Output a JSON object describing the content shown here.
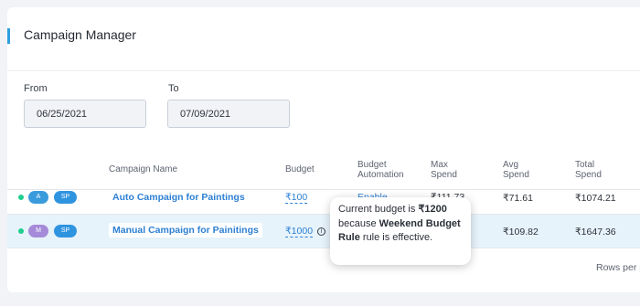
{
  "header": {
    "title": "Campaign Manager"
  },
  "filters": {
    "from_label": "From",
    "from_value": "06/25/2021",
    "to_label": "To",
    "to_value": "07/09/2021"
  },
  "table": {
    "columns": {
      "campaign_name": "Campaign Name",
      "budget": "Budget",
      "budget_automation_1": "Budget",
      "budget_automation_2": "Automation",
      "max_spend_1": "Max",
      "max_spend_2": "Spend",
      "avg_spend_1": "Avg",
      "avg_spend_2": "Spend",
      "total_spend_1": "Total",
      "total_spend_2": "Spend"
    },
    "rows": [
      {
        "status_color": "#1fcf8f",
        "badge_1": "A",
        "badge_2": "SP",
        "name": "Auto Campaign for Paintings",
        "budget": "₹100",
        "automation": "Enable",
        "max_spend": "₹111.73",
        "avg_spend": "₹71.61",
        "total_spend": "₹1074.21"
      },
      {
        "status_color": "#1fcf8f",
        "badge_1": "M",
        "badge_2": "SP",
        "name": "Manual Campaign for Painitings",
        "budget": "₹1000",
        "avg_spend": "₹109.82",
        "total_spend": "₹1647.36"
      }
    ]
  },
  "footer": {
    "rows_per_page_label": "Rows per p"
  },
  "tooltip": {
    "prefix": "Current budget is ",
    "amount": "₹1200",
    "middle": " because ",
    "rule": "Weekend Budget Rule",
    "suffix": " rule is effective."
  },
  "colors": {
    "accent": "#2d9ee0",
    "link": "#2d80d3",
    "status_active": "#1fcf8f",
    "selected_row": "#e7f3fb"
  }
}
